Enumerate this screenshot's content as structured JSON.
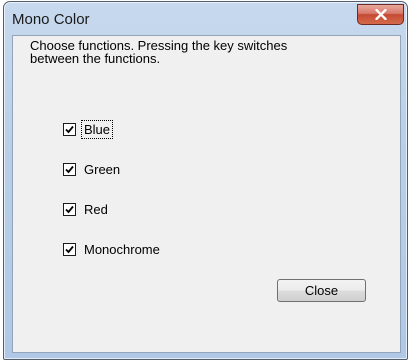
{
  "window": {
    "title": "Mono Color",
    "close_icon": "close-x-icon"
  },
  "dialog": {
    "prompt": "Choose functions. Pressing the key switches\nbetween the functions.",
    "options": [
      {
        "label": "Blue",
        "checked": true,
        "focused": true
      },
      {
        "label": "Green",
        "checked": true
      },
      {
        "label": "Red",
        "checked": true
      },
      {
        "label": "Monochrome",
        "checked": true
      }
    ],
    "close_label": "Close"
  },
  "colors": {
    "close_button_red": "#c64a35",
    "client_bg": "#f0f0f0",
    "frame_blue": "#b9cfe8"
  }
}
